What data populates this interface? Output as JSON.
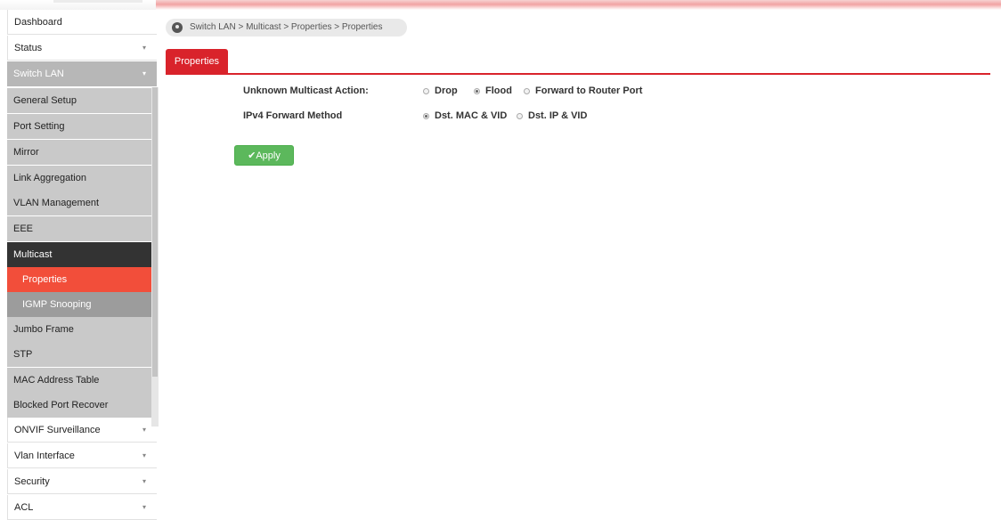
{
  "sidebar": {
    "dashboard": "Dashboard",
    "status": "Status",
    "switch_lan": "Switch LAN",
    "general_setup": "General Setup",
    "port_setting": "Port Setting",
    "mirror": "Mirror",
    "link_aggregation": "Link Aggregation",
    "vlan_management": "VLAN Management",
    "eee": "EEE",
    "multicast": "Multicast",
    "properties": "Properties",
    "igmp_snooping": "IGMP Snooping",
    "jumbo_frame": "Jumbo Frame",
    "stp": "STP",
    "mac_address_table": "MAC Address Table",
    "blocked_port_recover": "Blocked Port Recover",
    "onvif_surveillance": "ONVIF Surveillance",
    "vlan_interface": "Vlan Interface",
    "security": "Security",
    "acl": "ACL",
    "chevron": "▾"
  },
  "breadcrumb": "Switch LAN > Multicast > Properties  > Properties",
  "tab": "Properties",
  "form": {
    "unknown_multicast_label": "Unknown Multicast Action:",
    "unknown_multicast_options": [
      "Drop",
      "Flood",
      "Forward to Router Port"
    ],
    "unknown_multicast_selected": "Flood",
    "ipv4_label": "IPv4 Forward Method",
    "ipv4_options": [
      "Dst. MAC & VID",
      "Dst. IP & VID"
    ],
    "ipv4_selected": "Dst. MAC & VID"
  },
  "apply_label": "✔Apply",
  "colors": {
    "accent_red": "#d9232b",
    "active_item": "#f24e3a",
    "apply_green": "#5cb85c"
  }
}
